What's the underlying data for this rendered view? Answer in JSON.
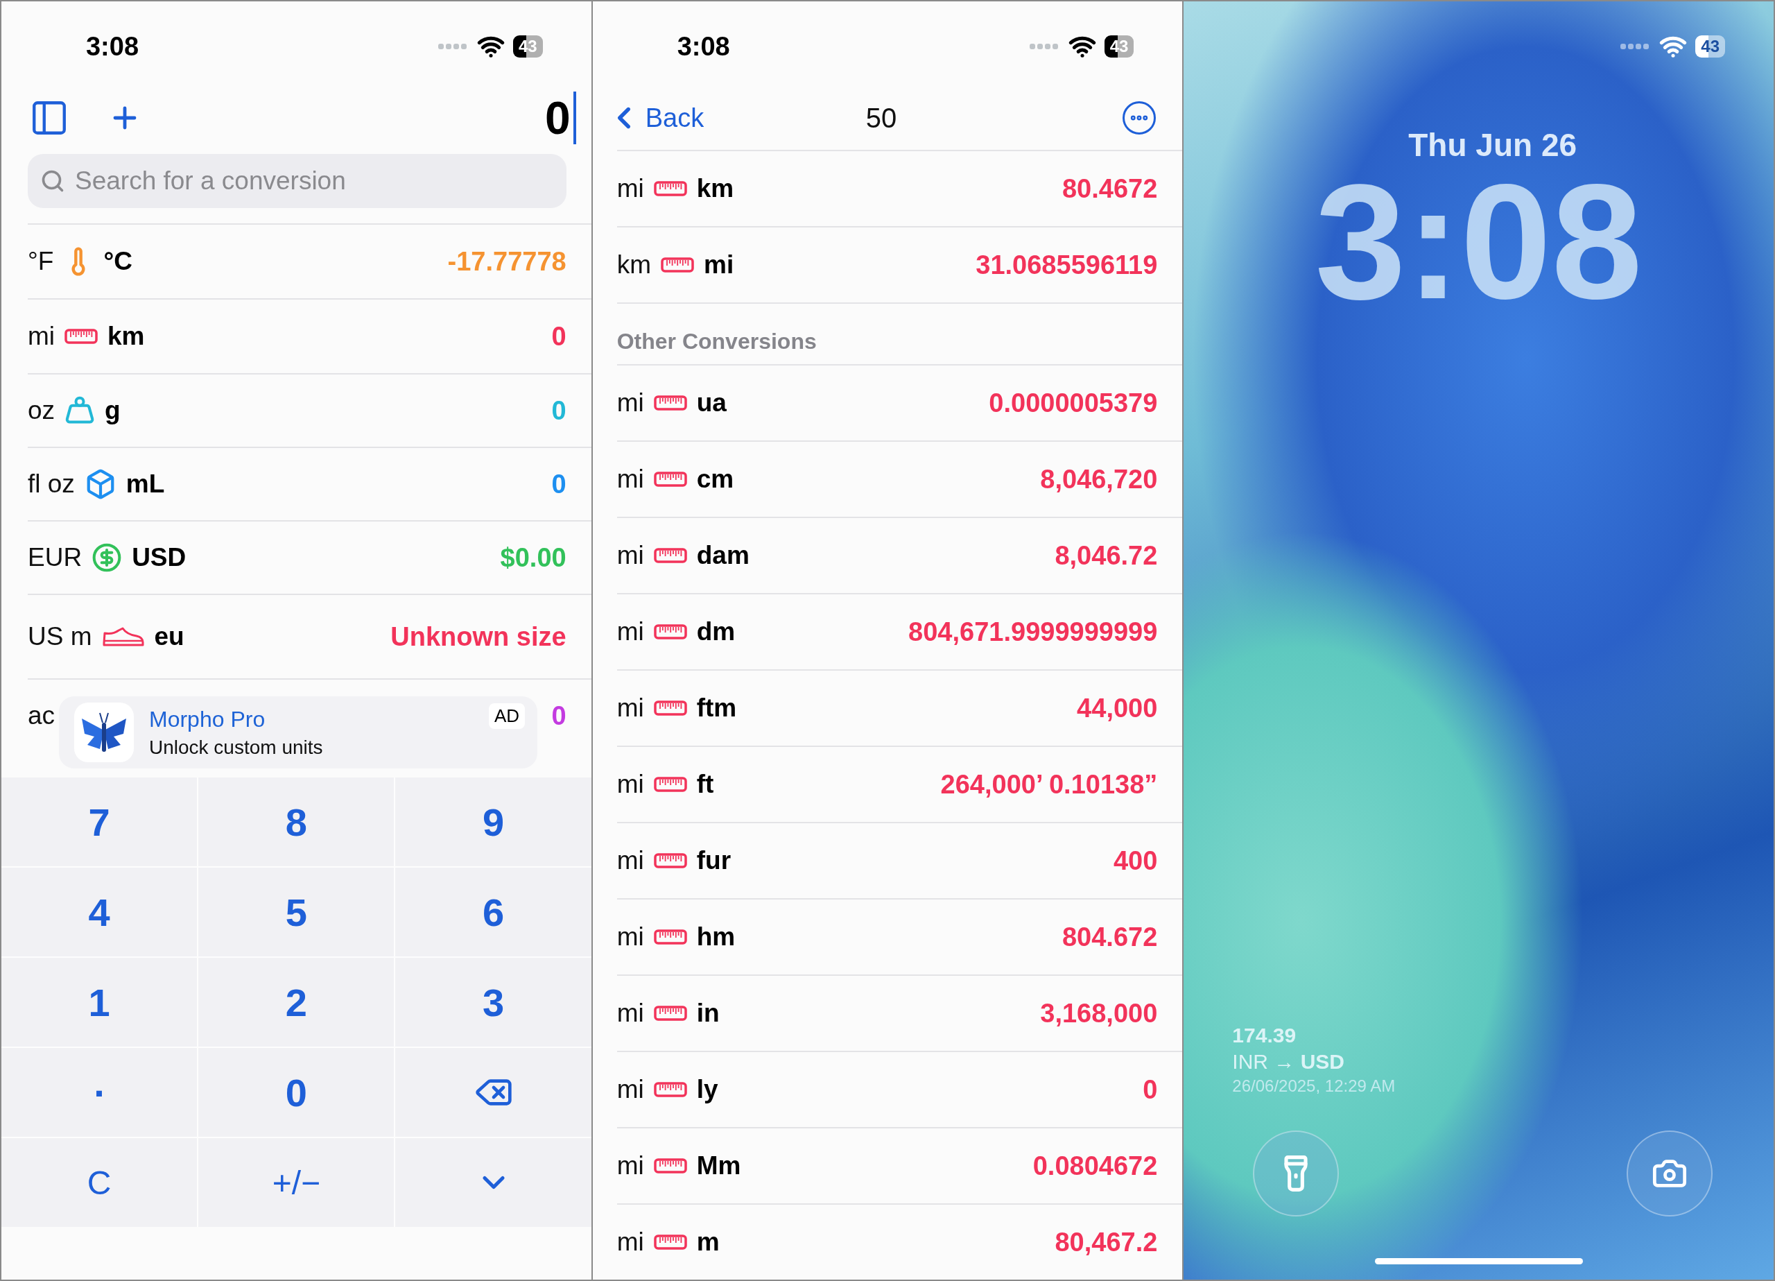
{
  "left_screen": {
    "status_bar": {
      "time": "3:08",
      "battery": "43"
    },
    "toolbar": {
      "value": "0"
    },
    "search": {
      "placeholder": "Search for a conversion"
    },
    "conversions": [
      {
        "from": "°F",
        "to": "°C",
        "kind": "temperature",
        "color": "#f59331",
        "value": "-17.77778"
      },
      {
        "from": "mi",
        "to": "km",
        "kind": "length",
        "color": "#f2335a",
        "value": "0"
      },
      {
        "from": "oz",
        "to": "g",
        "kind": "mass",
        "color": "#22b8d6",
        "value": "0"
      },
      {
        "from": "fl oz",
        "to": "mL",
        "kind": "volume",
        "color": "#1d8ff0",
        "value": "0"
      },
      {
        "from": "EUR",
        "to": "USD",
        "kind": "currency",
        "color": "#32c15a",
        "value": "$0.00"
      },
      {
        "from": "US m",
        "to": "eu",
        "kind": "shoe",
        "color": "#f2335a",
        "value": "Unknown size"
      },
      {
        "from": "ac",
        "color": "#c33be0",
        "value": "0"
      }
    ],
    "ad": {
      "title": "Morpho Pro",
      "subtitle": "Unlock custom units",
      "badge": "AD"
    },
    "keypad": [
      {
        "kind": "digit",
        "label": "7"
      },
      {
        "kind": "digit",
        "label": "8"
      },
      {
        "kind": "digit",
        "label": "9"
      },
      {
        "kind": "digit",
        "label": "4"
      },
      {
        "kind": "digit",
        "label": "5"
      },
      {
        "kind": "digit",
        "label": "6"
      },
      {
        "kind": "digit",
        "label": "1"
      },
      {
        "kind": "digit",
        "label": "2"
      },
      {
        "kind": "digit",
        "label": "3"
      },
      {
        "kind": "digit",
        "label": "."
      },
      {
        "kind": "digit",
        "label": "0"
      },
      {
        "kind": "backspace"
      },
      {
        "kind": "clear",
        "label": "C"
      },
      {
        "kind": "sign",
        "label": "+/−"
      },
      {
        "kind": "collapse"
      }
    ]
  },
  "middle_screen": {
    "status_bar": {
      "time": "3:08",
      "battery": "43"
    },
    "nav": {
      "back": "Back",
      "title": "50"
    },
    "primary": [
      {
        "from": "mi",
        "to": "km",
        "value": "80.4672"
      },
      {
        "from": "km",
        "to": "mi",
        "value": "31.0685596119"
      }
    ],
    "section_title": "Other Conversions",
    "other": [
      {
        "from": "mi",
        "to": "ua",
        "value": "0.0000005379"
      },
      {
        "from": "mi",
        "to": "cm",
        "value": "8,046,720"
      },
      {
        "from": "mi",
        "to": "dam",
        "value": "8,046.72"
      },
      {
        "from": "mi",
        "to": "dm",
        "value": "804,671.9999999999"
      },
      {
        "from": "mi",
        "to": "ftm",
        "value": "44,000"
      },
      {
        "from": "mi",
        "to": "ft",
        "value": "264,000’ 0.10138”"
      },
      {
        "from": "mi",
        "to": "fur",
        "value": "400"
      },
      {
        "from": "mi",
        "to": "hm",
        "value": "804.672"
      },
      {
        "from": "mi",
        "to": "in",
        "value": "3,168,000"
      },
      {
        "from": "mi",
        "to": "ly",
        "value": "0"
      },
      {
        "from": "mi",
        "to": "Mm",
        "value": "0.0804672"
      },
      {
        "from": "mi",
        "to": "m",
        "value": "80,467.2"
      }
    ]
  },
  "lock_screen": {
    "status_bar": {
      "battery": "43"
    },
    "date": "Thu Jun 26",
    "time": "3:08",
    "widget": {
      "value": "174.39",
      "pair": "INR → **USD**",
      "timestamp": "26/06/2025, 12:29 AM"
    }
  }
}
